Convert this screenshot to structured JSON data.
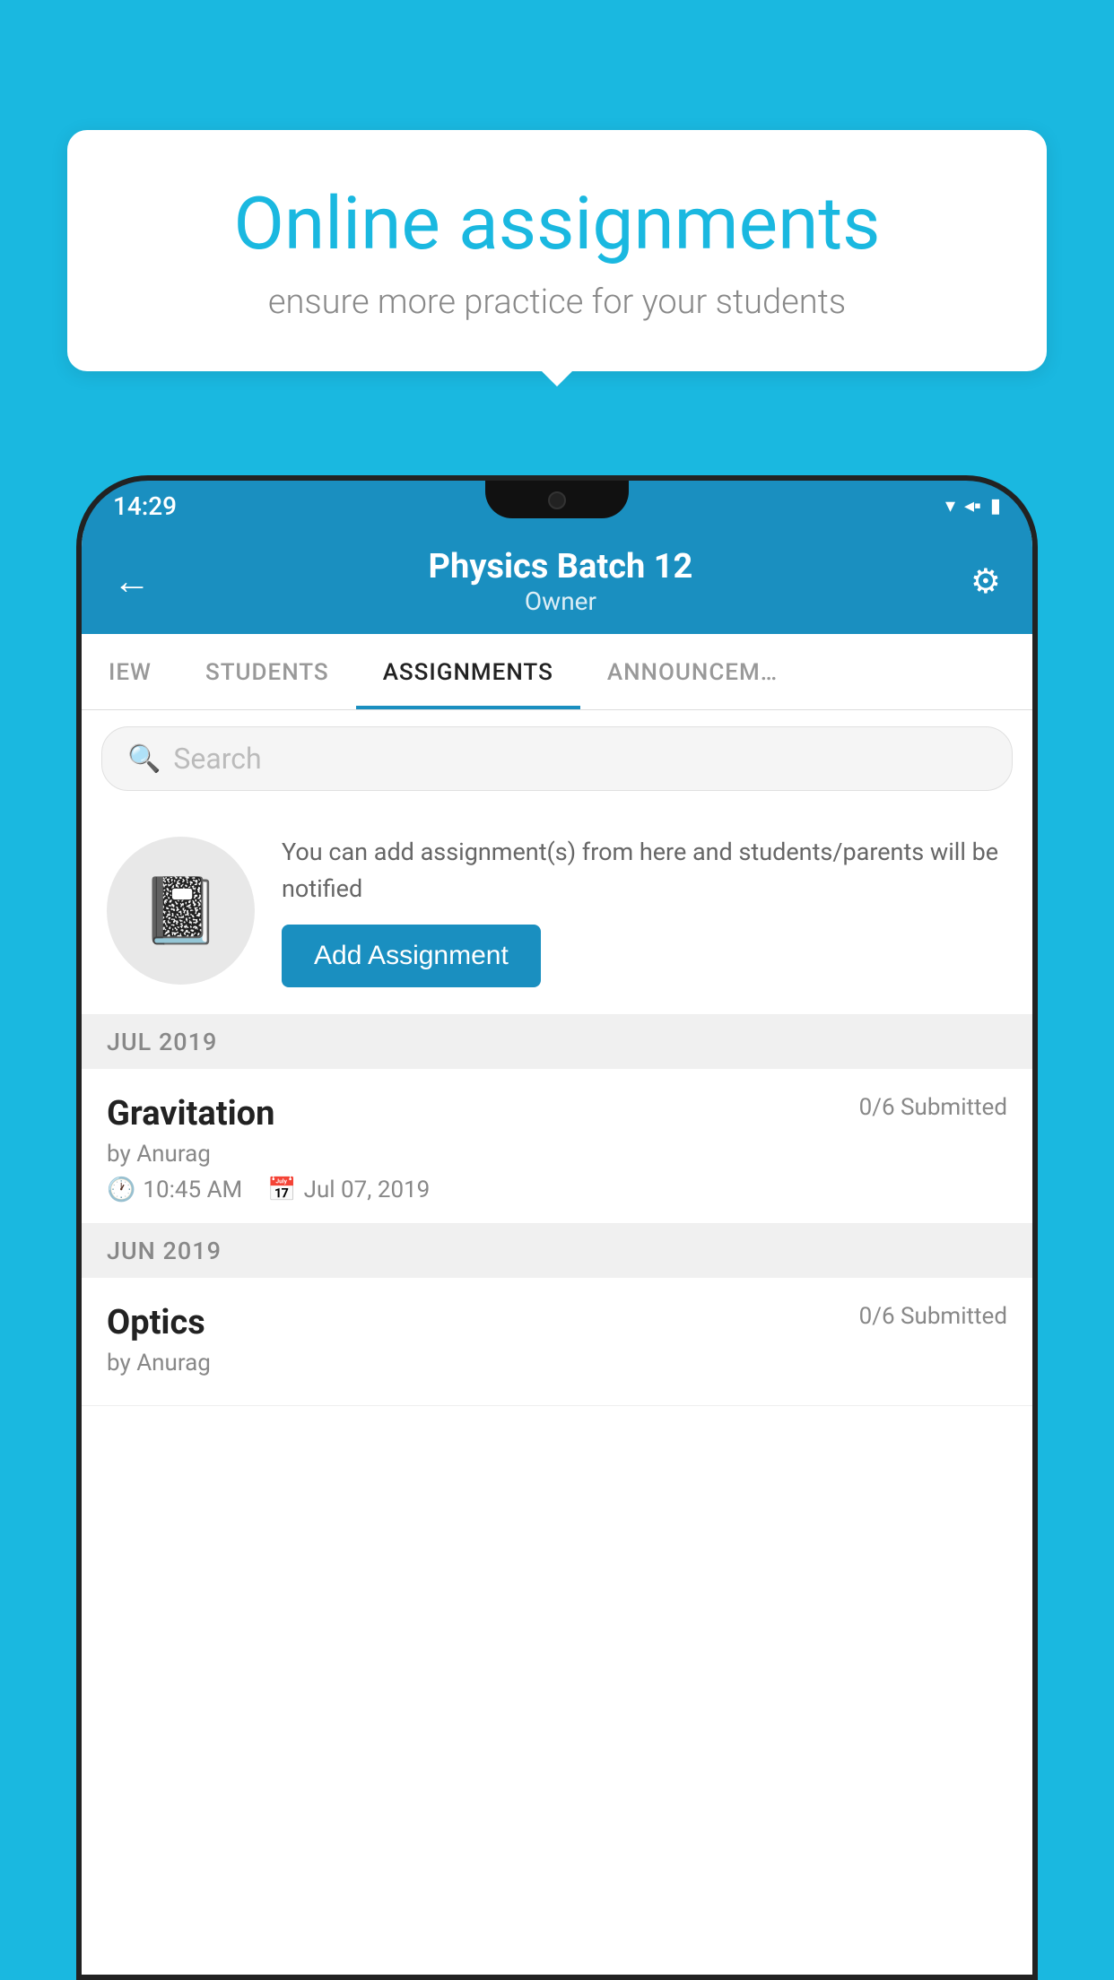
{
  "background_color": "#1ab8e0",
  "speech_bubble": {
    "title": "Online assignments",
    "subtitle": "ensure more practice for your students"
  },
  "status_bar": {
    "time": "14:29",
    "icons": [
      "wifi",
      "signal",
      "battery"
    ]
  },
  "app_header": {
    "title": "Physics Batch 12",
    "subtitle": "Owner",
    "back_label": "←",
    "settings_label": "⚙"
  },
  "tabs": [
    {
      "label": "IEW",
      "active": false
    },
    {
      "label": "STUDENTS",
      "active": false
    },
    {
      "label": "ASSIGNMENTS",
      "active": true
    },
    {
      "label": "ANNOUNCEM…",
      "active": false
    }
  ],
  "search": {
    "placeholder": "Search"
  },
  "assignment_promo": {
    "description": "You can add assignment(s) from here and students/parents will be notified",
    "button_label": "Add Assignment"
  },
  "sections": [
    {
      "month": "JUL 2019",
      "assignments": [
        {
          "name": "Gravitation",
          "submitted": "0/6 Submitted",
          "by": "by Anurag",
          "time": "10:45 AM",
          "date": "Jul 07, 2019"
        }
      ]
    },
    {
      "month": "JUN 2019",
      "assignments": [
        {
          "name": "Optics",
          "submitted": "0/6 Submitted",
          "by": "by Anurag",
          "time": "",
          "date": ""
        }
      ]
    }
  ]
}
